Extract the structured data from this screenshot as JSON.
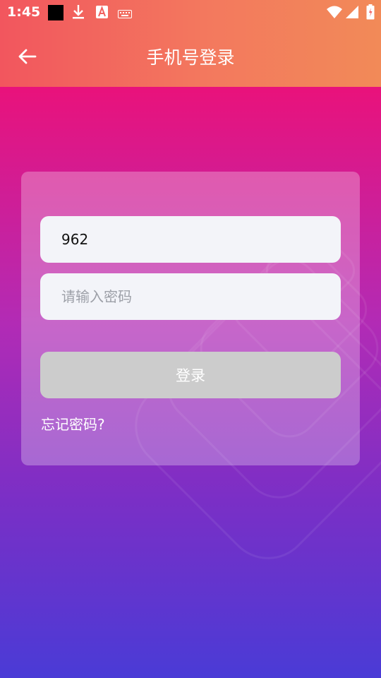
{
  "status_bar": {
    "time": "1:45",
    "icons": [
      "black-square-icon",
      "download-icon",
      "font-a-icon",
      "keyboard-icon",
      "wifi-icon",
      "cellular-icon",
      "battery-icon"
    ]
  },
  "header": {
    "title": "手机号登录",
    "back_icon": "arrow-left-icon"
  },
  "form": {
    "phone_value": "962",
    "password_placeholder": "请输入密码",
    "login_label": "登录",
    "forgot_label": "忘记密码?"
  },
  "colors": {
    "header_gradient": [
      "#f2565e",
      "#f28a58"
    ],
    "background_gradient": [
      "#e9127b",
      "#4a3bd6"
    ],
    "button_disabled": "#cccccc",
    "input_bg": "#f3f4f9"
  }
}
